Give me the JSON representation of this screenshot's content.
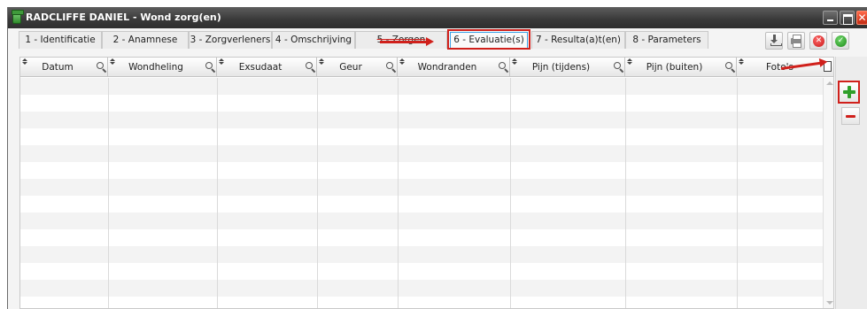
{
  "window": {
    "title": "RADCLIFFE DANIEL - Wond zorg(en)",
    "close_glyph": "✕"
  },
  "tabs": [
    {
      "label": "1 - Identificatie"
    },
    {
      "label": "2 - Anamnese"
    },
    {
      "label": "3 - Zorgverleners"
    },
    {
      "label": "4 - Omschrijving"
    },
    {
      "label": "5 - Zorgen"
    },
    {
      "label": "6 - Evaluatie(s)"
    },
    {
      "label": "7 - Resulta(a)t(en)"
    },
    {
      "label": "8 - Parameters"
    }
  ],
  "active_tab": "6 - Evaluatie(s)",
  "toolbar": {
    "cancel_glyph": "✕",
    "ok_glyph": "✓"
  },
  "table": {
    "columns": [
      {
        "label": "Datum"
      },
      {
        "label": "Wondheling"
      },
      {
        "label": "Exsudaat"
      },
      {
        "label": "Geur"
      },
      {
        "label": "Wondranden"
      },
      {
        "label": "Pijn (tijdens)"
      },
      {
        "label": "Pijn (buiten)"
      },
      {
        "label": "Foto's"
      }
    ],
    "row_count": 14
  },
  "colors": {
    "highlight": "#d0201b",
    "add_green": "#2f9f2a",
    "titlebar": "#3b3b3b",
    "active_tab_inner": "#3aa0e6"
  },
  "icons": [
    "app-icon",
    "minimize-icon",
    "maximize-icon",
    "close-icon",
    "download-icon",
    "print-icon",
    "cancel-icon",
    "confirm-icon",
    "sort-icon",
    "filter-icon",
    "photo-doc-icon",
    "plus-icon",
    "minus-icon",
    "annotation-arrow"
  ]
}
